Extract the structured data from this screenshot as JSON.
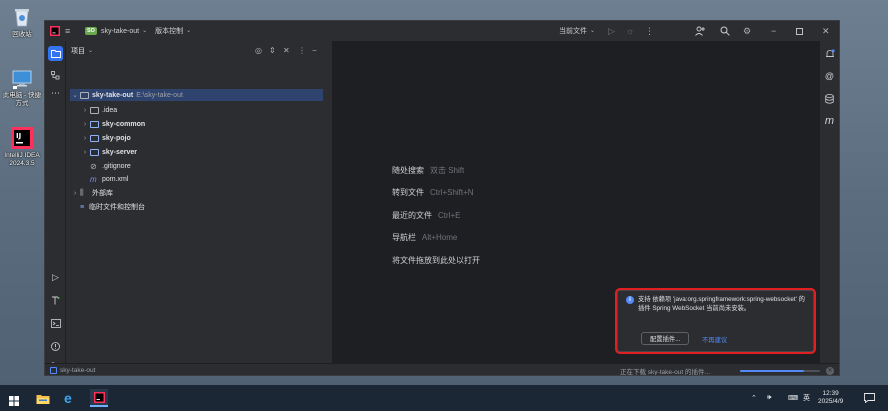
{
  "desktop": {
    "icons": [
      {
        "name": "recycle-bin",
        "label": "回收站"
      },
      {
        "name": "this-pc-shortcut",
        "label": "此电脑 - 快捷\n方式"
      },
      {
        "name": "intellij-idea",
        "label": "IntelliJ IDEA\n2024.3.5"
      }
    ]
  },
  "titlebar": {
    "project_badge": "SO",
    "project_name": "sky-take-out",
    "vcs_label": "版本控制",
    "run_config": "当前文件"
  },
  "project_panel": {
    "title": "项目",
    "root": {
      "name": "sky-take-out",
      "path": "E:\\sky-take-out"
    },
    "children": [
      {
        "label": ".idea",
        "type": "folder",
        "bold": false
      },
      {
        "label": "sky-common",
        "type": "module",
        "bold": true
      },
      {
        "label": "sky-pojo",
        "type": "module",
        "bold": true
      },
      {
        "label": "sky-server",
        "type": "module",
        "bold": true
      },
      {
        "label": ".gitignore",
        "type": "file",
        "bold": false
      },
      {
        "label": "pom.xml",
        "type": "maven",
        "bold": false
      }
    ],
    "external_libs": "外部库",
    "scratches": "临时文件和控制台"
  },
  "editor_hints": [
    {
      "action": "随处搜索",
      "shortcut": "双击 Shift"
    },
    {
      "action": "转到文件",
      "shortcut": "Ctrl+Shift+N"
    },
    {
      "action": "最近的文件",
      "shortcut": "Ctrl+E"
    },
    {
      "action": "导航栏",
      "shortcut": "Alt+Home"
    },
    {
      "action": "将文件拖放到此处以打开",
      "shortcut": ""
    }
  ],
  "statusbar": {
    "breadcrumb": "sky-take-out",
    "background_task": "正在下载 sky-take-out 的插件...",
    "progress": 0.8
  },
  "notification": {
    "message": "支持 依赖项 'java:org.springframework:spring-websocket' 的插件 Spring WebSocket 当前尚未安装。",
    "primary_button": "配置插件...",
    "secondary_link": "不再建议"
  },
  "taskbar": {
    "ime": "英",
    "time": "12:39",
    "date": "2025/4/9"
  },
  "colors": {
    "accent": "#548af7",
    "highlight_border": "#e02020",
    "ide_bg": "#1e1f22",
    "panel_bg": "#2b2d30"
  }
}
